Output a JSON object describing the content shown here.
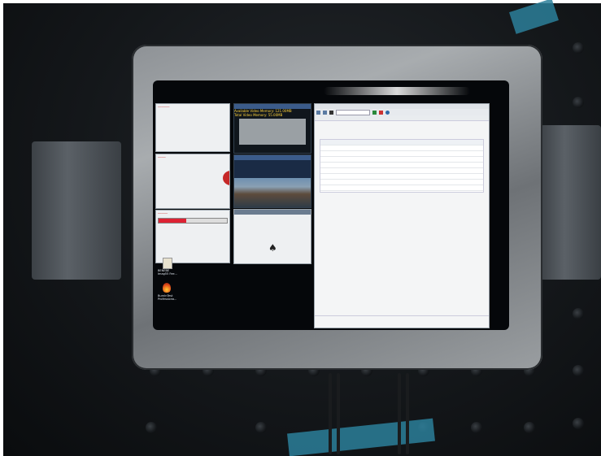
{
  "screen": {
    "video_window": {
      "line1": "Available Video Memory: 121.00MB",
      "line2": "Total Video Memory: 55.00MB"
    },
    "desktop_icons": [
      {
        "name": "icon-1",
        "label": "BENEBE\nImag55 Fee..."
      },
      {
        "name": "icon-2",
        "label": "BurnInTest\nProfessiona..."
      }
    ]
  },
  "colors": {
    "panel": "#a8acaf",
    "accent_blue": "#3b5b8a",
    "tape": "#2b7f9a"
  }
}
